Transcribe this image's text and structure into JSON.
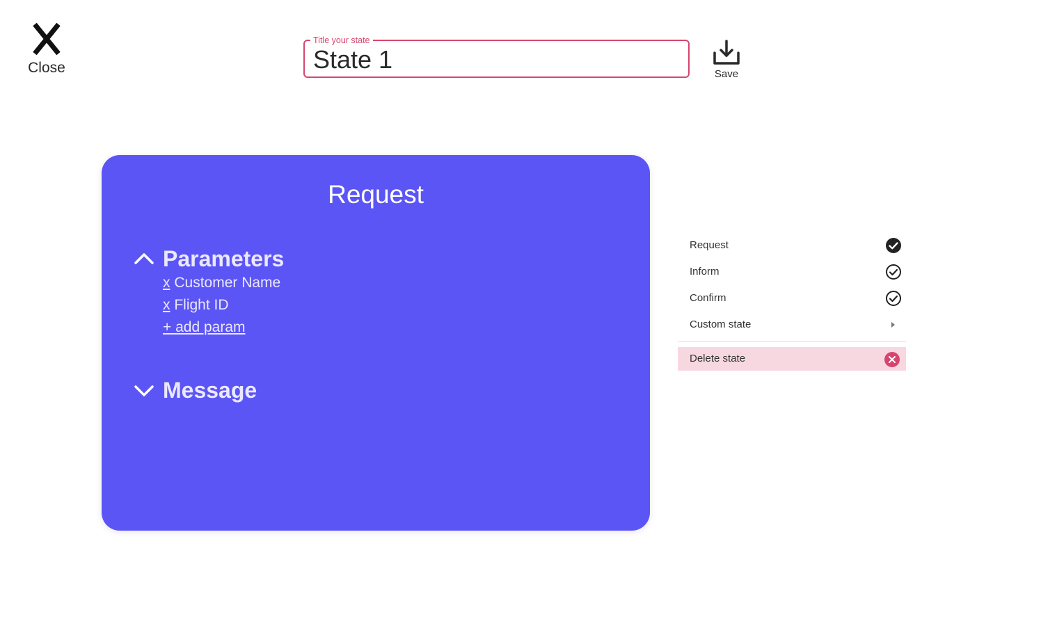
{
  "header": {
    "close_label": "Close",
    "save_label": "Save"
  },
  "title_field": {
    "legend": "Title your state",
    "value": "State 1"
  },
  "card": {
    "title": "Request",
    "background": "#5b55f5",
    "parameters": {
      "heading": "Parameters",
      "expanded": true,
      "items": [
        {
          "remove": "x",
          "name": "Customer Name"
        },
        {
          "remove": "x",
          "name": "Flight ID"
        }
      ],
      "add_label": "+ add param"
    },
    "message": {
      "heading": "Message",
      "expanded": false
    }
  },
  "state_menu": {
    "items": [
      {
        "label": "Request",
        "icon": "check-circle-filled-icon",
        "selected": true
      },
      {
        "label": "Inform",
        "icon": "check-circle-outline-icon",
        "selected": false
      },
      {
        "label": "Confirm",
        "icon": "check-circle-outline-icon",
        "selected": false
      },
      {
        "label": "Custom state",
        "icon": "caret-right-icon",
        "selected": false
      }
    ],
    "delete_label": "Delete state",
    "delete_icon": "close-circle-icon"
  },
  "colors": {
    "accent": "#d6456f",
    "card": "#5b55f5",
    "danger_bg": "#f7d8e0"
  }
}
